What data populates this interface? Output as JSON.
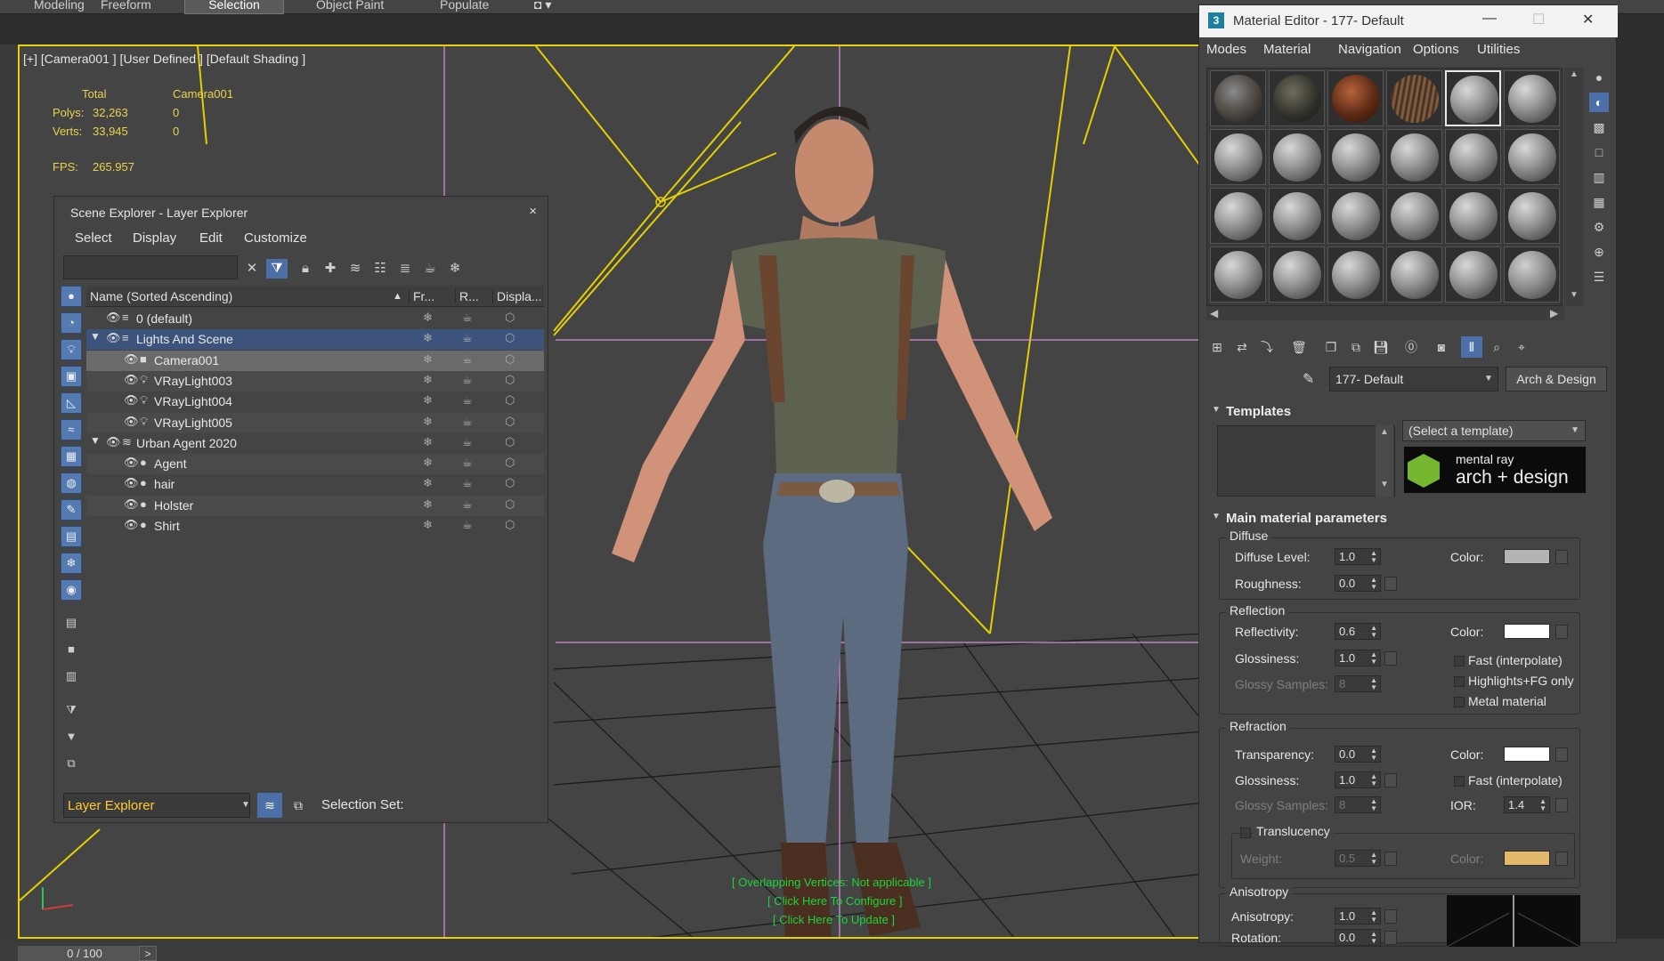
{
  "ribbon": {
    "tabs": [
      "Modeling",
      "Freeform",
      "Selection",
      "Object Paint",
      "Populate"
    ],
    "active_tab": "Selection"
  },
  "viewport": {
    "label": "[+] [Camera001 ] [User Defined ] [Default Shading ]",
    "stats": {
      "header_total": "Total",
      "header_camera": "Camera001",
      "polys_label": "Polys:",
      "polys_total": "32,263",
      "polys_camera": "0",
      "verts_label": "Verts:",
      "verts_total": "33,945",
      "verts_camera": "0",
      "fps_label": "FPS:",
      "fps_value": "265.957"
    },
    "messages": {
      "overlap": "[ Overlapping Vertices: Not applicable ]",
      "configure": "[ Click Here To Configure ]",
      "update": "[ Click Here To Update ]"
    },
    "frame_counter": "0 / 100",
    "frame_next": ">",
    "colors": {
      "border": "#e7d100",
      "message": "#1bd63a",
      "stats": "#e8d54a"
    }
  },
  "scene_explorer": {
    "title": "Scene Explorer - Layer Explorer",
    "close": "×",
    "menu": [
      "Select",
      "Display",
      "Edit",
      "Customize"
    ],
    "columns": {
      "name": "Name (Sorted Ascending)",
      "sort_indicator": "▲",
      "freeze": "Fr...",
      "render": "R...",
      "display": "Displa..."
    },
    "rows": [
      {
        "name": "0 (default)",
        "level": 0,
        "twisty": "",
        "icon": "layer-icon",
        "kind": "layer"
      },
      {
        "name": "Lights And Scene",
        "level": 0,
        "twisty": "▼",
        "icon": "layer-icon",
        "kind": "layer-selected"
      },
      {
        "name": "Camera001",
        "level": 1,
        "twisty": "",
        "icon": "camera-icon",
        "kind": "item-selected"
      },
      {
        "name": "VRayLight003",
        "level": 1,
        "twisty": "",
        "icon": "light-icon",
        "kind": "item"
      },
      {
        "name": "VRayLight004",
        "level": 1,
        "twisty": "",
        "icon": "light-icon",
        "kind": "item"
      },
      {
        "name": "VRayLight005",
        "level": 1,
        "twisty": "",
        "icon": "light-icon",
        "kind": "item"
      },
      {
        "name": "Urban Agent 2020",
        "level": 0,
        "twisty": "▼",
        "icon": "layer-stack-icon",
        "kind": "layer"
      },
      {
        "name": "Agent",
        "level": 1,
        "twisty": "",
        "icon": "object-icon",
        "kind": "item"
      },
      {
        "name": "hair",
        "level": 1,
        "twisty": "",
        "icon": "object-icon",
        "kind": "item"
      },
      {
        "name": "Holster",
        "level": 1,
        "twisty": "",
        "icon": "object-icon",
        "kind": "item"
      },
      {
        "name": "Shirt",
        "level": 1,
        "twisty": "",
        "icon": "object-icon",
        "kind": "item"
      }
    ],
    "bottom": {
      "explorer_type": "Layer Explorer",
      "selection_set_label": "Selection Set:"
    },
    "colors": {
      "selected_layer": "#3c547c",
      "explorer_type_text": "#ffcc33",
      "toggle_on": "#4d6fa7"
    }
  },
  "material_editor": {
    "title": "Material Editor - 177- Default",
    "logo": "3",
    "menu": [
      "Modes",
      "Material",
      "Navigation",
      "Options",
      "Utilities"
    ],
    "material_name": "177- Default",
    "material_type": "Arch & Design",
    "templates": {
      "header": "Templates",
      "select_placeholder": "(Select a template)",
      "logo_line1": "mental ray",
      "logo_line2": "arch + design"
    },
    "main_params": {
      "header": "Main material parameters",
      "diffuse": {
        "title": "Diffuse",
        "level_label": "Diffuse Level:",
        "level_value": "1.0",
        "roughness_label": "Roughness:",
        "roughness_value": "0.0",
        "color_label": "Color:",
        "color": "#b4b4b4"
      },
      "reflection": {
        "title": "Reflection",
        "reflectivity_label": "Reflectivity:",
        "reflectivity_value": "0.6",
        "glossiness_label": "Glossiness:",
        "glossiness_value": "1.0",
        "glossy_samples_label": "Glossy Samples:",
        "glossy_samples_value": "8",
        "color_label": "Color:",
        "color": "#ffffff",
        "fast_label": "Fast (interpolate)",
        "highlights_label": "Highlights+FG only",
        "metal_label": "Metal material"
      },
      "refraction": {
        "title": "Refraction",
        "transparency_label": "Transparency:",
        "transparency_value": "0.0",
        "glossiness_label": "Glossiness:",
        "glossiness_value": "1.0",
        "glossy_samples_label": "Glossy Samples:",
        "glossy_samples_value": "8",
        "color_label": "Color:",
        "color": "#ffffff",
        "fast_label": "Fast (interpolate)",
        "ior_label": "IOR:",
        "ior_value": "1.4"
      },
      "translucency": {
        "title": "Translucency",
        "weight_label": "Weight:",
        "weight_value": "0.5",
        "color_label": "Color:",
        "color": "#e2b96b"
      },
      "anisotropy": {
        "title": "Anisotropy",
        "anisotropy_label": "Anisotropy:",
        "anisotropy_value": "1.0",
        "rotation_label": "Rotation:",
        "rotation_value": "0.0"
      }
    }
  }
}
